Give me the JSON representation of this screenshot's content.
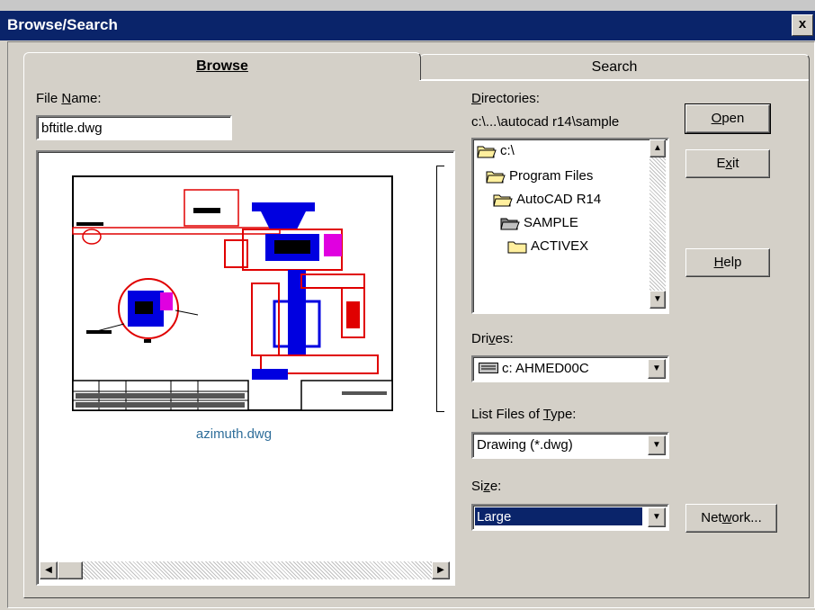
{
  "window": {
    "title": "Browse/Search",
    "close_label": "x"
  },
  "tabs": [
    {
      "label": "Browse",
      "active": true
    },
    {
      "label": "Search",
      "active": false
    }
  ],
  "file_name": {
    "label_pre": "File ",
    "label_key": "N",
    "label_post": "ame:",
    "value": "bftitle.dwg"
  },
  "preview": {
    "caption": "azimuth.dwg",
    "caption_color": "#2f6e9a"
  },
  "directories": {
    "label_key": "D",
    "label_post": "irectories:",
    "path": "c:\\...\\autocad r14\\sample",
    "items": [
      {
        "label": "c:\\",
        "state": "open"
      },
      {
        "label": "Program Files",
        "state": "open"
      },
      {
        "label": "AutoCAD R14",
        "state": "open"
      },
      {
        "label": "SAMPLE",
        "state": "selected"
      },
      {
        "label": "ACTIVEX",
        "state": "closed"
      }
    ]
  },
  "drives": {
    "label_pre": "Dri",
    "label_key": "v",
    "label_post": "es:",
    "value": "c: AHMED00C",
    "icon": "drive-icon"
  },
  "list_type": {
    "label_pre": "List Files of ",
    "label_key": "T",
    "label_post": "ype:",
    "value": "Drawing (*.dwg)"
  },
  "size": {
    "label_pre": "Si",
    "label_key": "z",
    "label_post": "e:",
    "value": "Large"
  },
  "buttons": {
    "open": {
      "key": "O",
      "rest": "pen"
    },
    "exit": {
      "pre": "E",
      "key": "x",
      "rest": "it"
    },
    "help": {
      "key": "H",
      "rest": "elp"
    },
    "network": {
      "pre": "Net",
      "key": "w",
      "rest": "ork..."
    }
  },
  "colors": {
    "titlebar": "#0a246a",
    "face": "#d4d0c8",
    "selection": "#0a246a"
  }
}
